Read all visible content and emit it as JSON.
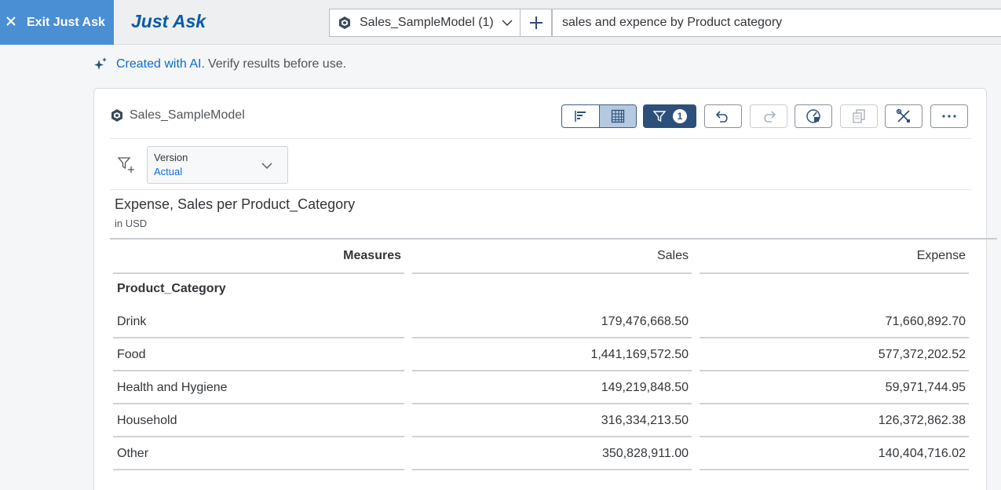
{
  "topbar": {
    "exit_label": "Exit Just Ask",
    "app_title": "Just Ask",
    "model_label": "Sales_SampleModel (1)",
    "query_value": "sales and expence by Product category"
  },
  "ai_note": {
    "link_text": "Created with AI.",
    "rest_text": "Verify results before use."
  },
  "card": {
    "model_name": "Sales_SampleModel",
    "filter_count": "1",
    "version_key": "Version",
    "version_value": "Actual",
    "table_title": "Expense, Sales per Product_Category",
    "table_subtitle": "in USD",
    "columns": [
      "Measures",
      "Sales",
      "Expense"
    ],
    "row_dimension": "Product_Category",
    "rows": [
      {
        "label": "Drink",
        "sales": "179,476,668.50",
        "expense": "71,660,892.70"
      },
      {
        "label": "Food",
        "sales": "1,441,169,572.50",
        "expense": "577,372,202.52"
      },
      {
        "label": "Health and Hygiene",
        "sales": "149,219,848.50",
        "expense": "59,971,744.95"
      },
      {
        "label": "Household",
        "sales": "316,334,213.50",
        "expense": "126,372,862.38"
      },
      {
        "label": "Other",
        "sales": "350,828,911.00",
        "expense": "140,404,716.02"
      }
    ]
  },
  "colors": {
    "accent": "#0a6ed1",
    "exit_bg": "#4a8fd3",
    "title": "#0a5ba6",
    "filter_active": "#2c5079"
  }
}
